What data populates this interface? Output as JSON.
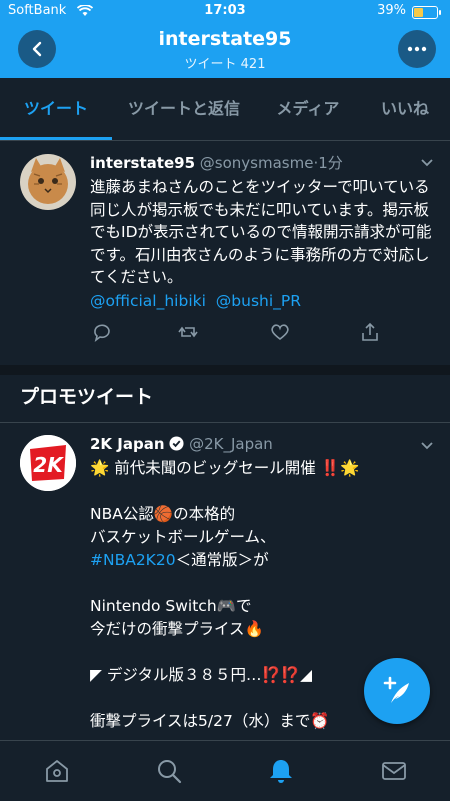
{
  "status_bar": {
    "carrier": "SoftBank",
    "time": "17:03",
    "battery": "39%",
    "battery_level": 0.39
  },
  "header": {
    "title": "interstate95",
    "subtitle": "ツイート 421",
    "back_icon": "back-arrow-icon",
    "more_icon": "more-icon"
  },
  "tabs": [
    {
      "label": "ツイート",
      "active": true
    },
    {
      "label": "ツイートと返信",
      "active": false
    },
    {
      "label": "メディア",
      "active": false
    },
    {
      "label": "いいね",
      "active": false
    }
  ],
  "tweet1": {
    "name": "interstate95",
    "handle": "@sonysmasme",
    "time": "1分",
    "text": "進藤あまねさんのことをツイッターで叩いている同じ人が掲示板でも未だに叩いています。掲示板でもIDが表示されているので情報開示請求が可能です。石川由衣さんのように事務所の方で対応してください。",
    "mentions": [
      "@official_hibiki",
      "@bushi_PR"
    ]
  },
  "promo": {
    "title": "プロモツイート"
  },
  "tweet2": {
    "name": "2K Japan",
    "handle": "@2K_Japan",
    "line1": "🌟 前代未聞のビッグセール開催 ‼️🌟",
    "line2": "NBA公認🏀の本格的",
    "line3": "バスケットボールゲーム、",
    "hashtag": "#NBA2K20",
    "line4_rest": "＜通常版＞が",
    "line5": "Nintendo Switch🎮で",
    "line6": "今だけの衝撃プライス🔥",
    "line7": "◤ デジタル版３８５円…⁉️⁉️◢",
    "line8": "衝撃プライスは5/27（水）まで⏰",
    "logo_text": "2K"
  },
  "colors": {
    "accent": "#1da1f2",
    "background": "#15202b",
    "secondary_text": "#8899a6"
  }
}
